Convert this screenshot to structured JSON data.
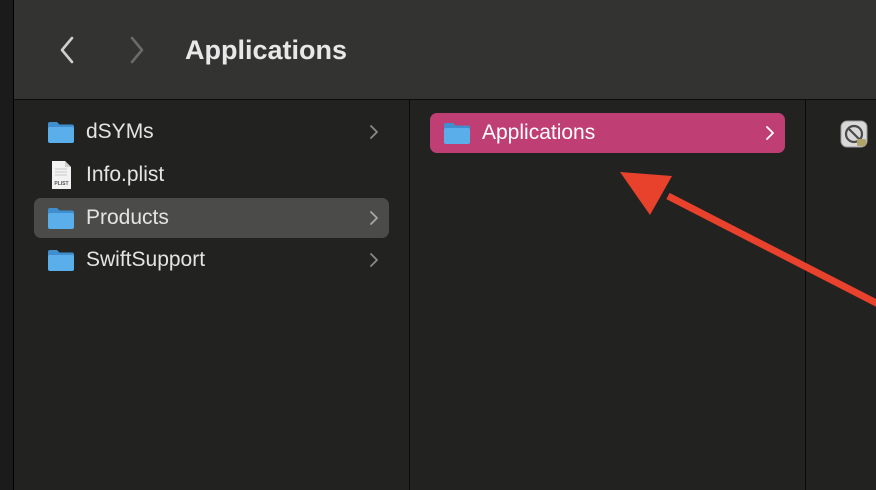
{
  "toolbar": {
    "title": "Applications",
    "back_icon": "chevron-left-icon",
    "forward_icon": "chevron-right-icon"
  },
  "column1": {
    "items": [
      {
        "label": "dSYMs",
        "icon": "folder-icon",
        "has_chevron": true
      },
      {
        "label": "Info.plist",
        "icon": "plist-file-icon",
        "icon_text": "PLIST",
        "has_chevron": false
      },
      {
        "label": "Products",
        "icon": "folder-icon",
        "has_chevron": true,
        "selected": true
      },
      {
        "label": "SwiftSupport",
        "icon": "folder-icon",
        "has_chevron": true
      }
    ]
  },
  "column2": {
    "items": [
      {
        "label": "Applications",
        "icon": "folder-icon",
        "has_chevron": true,
        "selected": true
      }
    ]
  },
  "column3": {
    "items": [
      {
        "icon": "app-prohibited-icon"
      }
    ]
  },
  "annotation": {
    "arrow_color": "#e8412c"
  },
  "colors": {
    "accent_selection": "#bf3f74",
    "inactive_selection": "#4b4b4a",
    "folder_blue": "#5aaeea"
  }
}
